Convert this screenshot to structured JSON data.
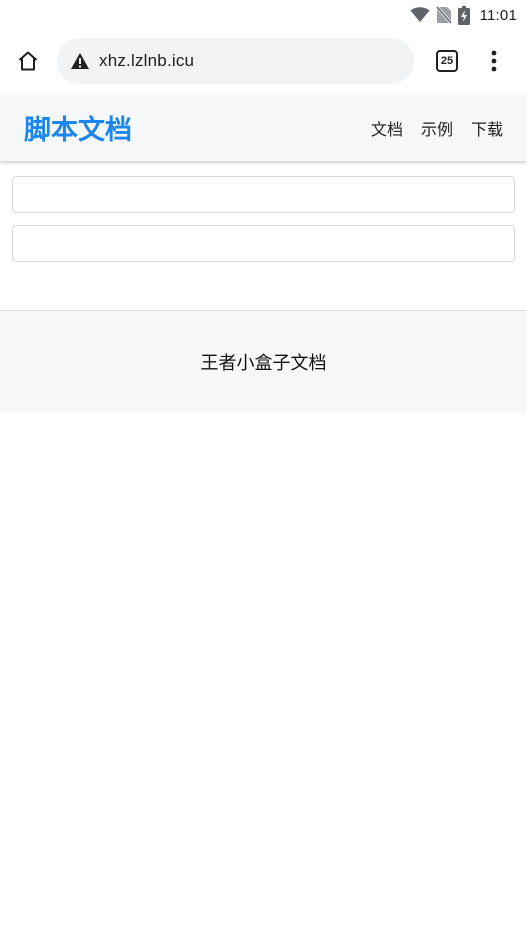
{
  "status_bar": {
    "time": "11:01",
    "icons": [
      "wifi-icon",
      "no-sim-icon",
      "battery-charging-icon"
    ]
  },
  "browser": {
    "url": "xhz.lzlnb.icu",
    "tab_count": "25",
    "icons": [
      "home-icon",
      "not-secure-warning-icon",
      "more-vert-icon"
    ]
  },
  "site": {
    "brand": "脚本文档",
    "brand_color": "#1a86f0",
    "nav": [
      "文档",
      "示例",
      "下载"
    ]
  },
  "form": {
    "field1_value": "",
    "field2_value": ""
  },
  "footer": {
    "text": "王者小盒子文档"
  }
}
